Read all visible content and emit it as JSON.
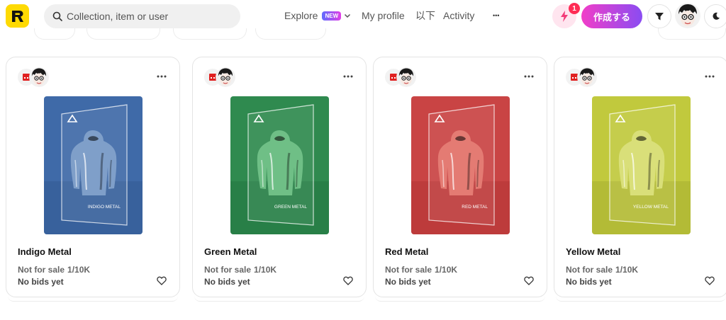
{
  "header": {
    "logo_letter": "R",
    "search": {
      "placeholder": "Collection, item or user",
      "value": ""
    },
    "nav": {
      "explore_label": "Explore",
      "explore_badge": "NEW",
      "profile_label": "My profile",
      "below_label": "以下",
      "activity_label": "Activity",
      "more_label": "•••"
    },
    "notifications_count": "1",
    "create_label": "作成する"
  },
  "colors": {
    "brand_yellow": "#feda03",
    "accent_pink": "#f13ec8",
    "accent_purple": "#8a4cf2"
  },
  "cards": [
    {
      "title": "Indigo Metal",
      "status": "Not for sale",
      "edition": "1/10K",
      "bids": "No bids yet",
      "art_label": "INDIGO METAL",
      "art_bg": "#3f6aa8",
      "art_dark": "#2c4f86",
      "art_metal": "#7f9fc9"
    },
    {
      "title": "Green Metal",
      "status": "Not for sale",
      "edition": "1/10K",
      "bids": "No bids yet",
      "art_label": "GREEN METAL",
      "art_bg": "#2f8a4f",
      "art_dark": "#1e6b39",
      "art_metal": "#6fbf86"
    },
    {
      "title": "Red Metal",
      "status": "Not for sale",
      "edition": "1/10K",
      "bids": "No bids yet",
      "art_label": "RED METAL",
      "art_bg": "#c94444",
      "art_dark": "#a52b2b",
      "art_metal": "#e47b73"
    },
    {
      "title": "Yellow Metal",
      "status": "Not for sale",
      "edition": "1/10K",
      "bids": "No bids yet",
      "art_label": "YELLOW METAL",
      "art_bg": "#c1c93d",
      "art_dark": "#9aa12a",
      "art_metal": "#d9df79"
    }
  ]
}
